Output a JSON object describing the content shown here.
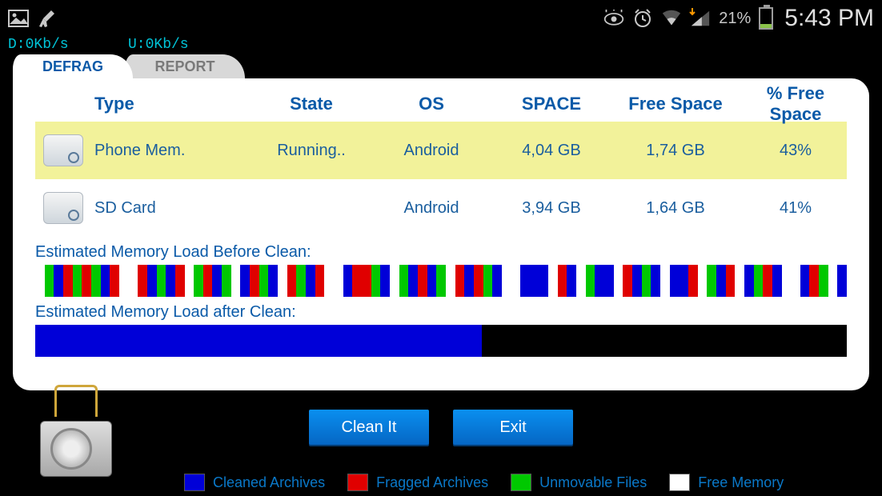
{
  "statusbar": {
    "battery_pct": "21%",
    "clock": "5:43 PM"
  },
  "speed": {
    "down": "D:0Kb/s",
    "up": "U:0Kb/s"
  },
  "tabs": {
    "active": "DEFRAG",
    "inactive": "REPORT"
  },
  "table": {
    "headers": {
      "type": "Type",
      "state": "State",
      "os": "OS",
      "space": "SPACE",
      "free": "Free Space",
      "pctfree": "% Free Space"
    },
    "rows": [
      {
        "type": "Phone Mem.",
        "state": "Running..",
        "os": "Android",
        "space": "4,04 GB",
        "free": "1,74 GB",
        "pctfree": "43%",
        "selected": true
      },
      {
        "type": "SD Card",
        "state": "",
        "os": "Android",
        "space": "3,94 GB",
        "free": "1,64 GB",
        "pctfree": "41%",
        "selected": false
      }
    ]
  },
  "memload": {
    "before_label": "Estimated Memory Load Before Clean:",
    "after_label": "Estimated Memory Load after Clean:",
    "before_segments": [
      "white",
      "green",
      "blue",
      "red",
      "green",
      "red",
      "green",
      "blue",
      "red",
      "white",
      "white",
      "red",
      "blue",
      "green",
      "blue",
      "red",
      "white",
      "green",
      "red",
      "blue",
      "green",
      "white",
      "blue",
      "red",
      "green",
      "blue",
      "white",
      "red",
      "green",
      "blue",
      "red",
      "white",
      "white",
      "blue",
      "red",
      "red",
      "green",
      "blue",
      "white",
      "green",
      "blue",
      "red",
      "blue",
      "green",
      "white",
      "red",
      "blue",
      "red",
      "green",
      "blue",
      "white",
      "white",
      "blue",
      "blue",
      "blue",
      "white",
      "red",
      "blue",
      "white",
      "green",
      "blue",
      "blue",
      "white",
      "red",
      "blue",
      "green",
      "blue",
      "white",
      "blue",
      "blue",
      "red",
      "white",
      "green",
      "blue",
      "red",
      "white",
      "blue",
      "green",
      "red",
      "blue",
      "white",
      "white",
      "blue",
      "red",
      "green",
      "white",
      "blue"
    ],
    "after_fill_pct": 55
  },
  "buttons": {
    "clean": "Clean It",
    "exit": "Exit"
  },
  "legend": {
    "cleaned": {
      "color": "#0000d8",
      "label": "Cleaned Archives"
    },
    "fragged": {
      "color": "#e00000",
      "label": "Fragged Archives"
    },
    "unmovable": {
      "color": "#00c800",
      "label": "Unmovable Files"
    },
    "free": {
      "color": "#ffffff",
      "label": "Free Memory"
    }
  }
}
